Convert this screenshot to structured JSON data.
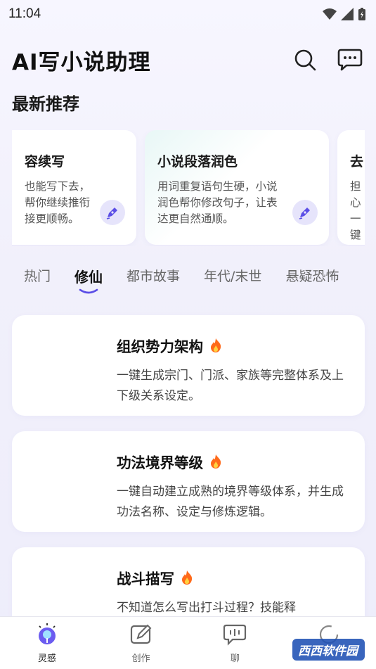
{
  "status_bar": {
    "time": "11:04"
  },
  "header": {
    "title": "AI写小说助理",
    "search_icon": "search-icon",
    "message_icon": "message-icon"
  },
  "recommend": {
    "title": "最新推荐",
    "cards": [
      {
        "title": "容续写",
        "desc": "也能写下去，帮你继续推衔接更顺畅。"
      },
      {
        "title": "小说段落润色",
        "desc": "用词重复语句生硬，小说润色帮你修改句子，让表达更自然通顺。"
      },
      {
        "title": "去",
        "desc": "担心一键更"
      }
    ]
  },
  "tabs": [
    {
      "label": "热门"
    },
    {
      "label": "修仙"
    },
    {
      "label": "都市故事"
    },
    {
      "label": "年代/末世"
    },
    {
      "label": "悬疑恐怖"
    }
  ],
  "active_tab": "修仙",
  "features": [
    {
      "title": "组织势力架构",
      "desc": "一键生成宗门、门派、家族等完整体系及上下级关系设定。"
    },
    {
      "title": "功法境界等级",
      "desc": "一键自动建立成熟的境界等级体系，并生成功法名称、设定与修炼逻辑。"
    },
    {
      "title": "战斗描写",
      "desc": "不知道怎么写出打斗过程？技能释"
    }
  ],
  "bottom_nav": [
    {
      "label": "灵感",
      "icon": "bulb-icon"
    },
    {
      "label": "创作",
      "icon": "edit-icon"
    },
    {
      "label": "聊",
      "icon": "chat-icon"
    },
    {
      "label": "",
      "icon": "loading-icon"
    }
  ],
  "watermark": {
    "text": "西西软件园"
  },
  "colors": {
    "accent": "#5b4ee6",
    "fire": "#ff6a1a",
    "text": "#111111"
  }
}
